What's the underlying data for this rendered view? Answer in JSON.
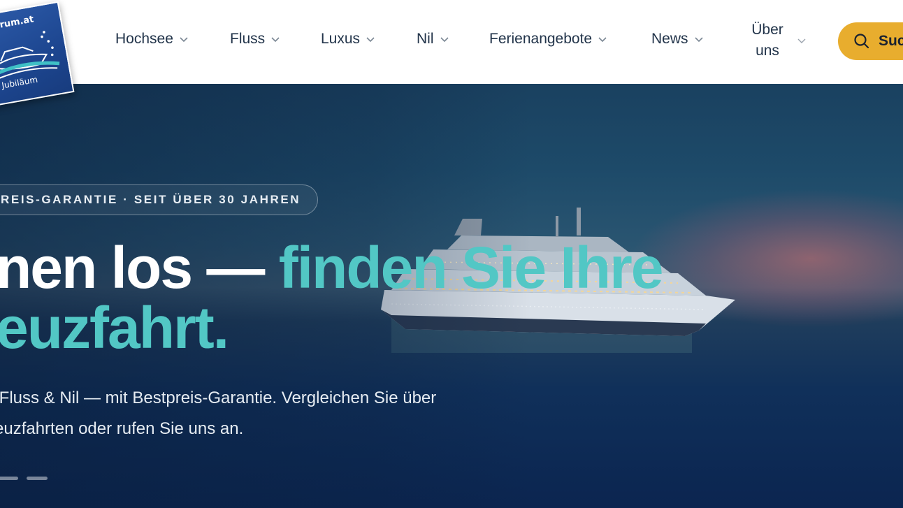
{
  "logo": {
    "top_text": "ntrum.at",
    "bottom_text": "e Jubiläum"
  },
  "nav": {
    "items": [
      {
        "label": "Hochsee"
      },
      {
        "label": "Fluss"
      },
      {
        "label": "Luxus"
      },
      {
        "label": "Nil"
      },
      {
        "label": "Ferienangebote"
      },
      {
        "label": "News"
      },
      {
        "label_line1": "Über",
        "label_line2": "uns"
      }
    ],
    "search_label": "Suc"
  },
  "hero": {
    "badge": "REIS-GARANTIE · SEIT ÜBER 30 JAHREN",
    "headline_white": "nen los — ",
    "headline_accent_1": "finden Sie Ihre",
    "headline_accent_2": "euzfahrt.",
    "subtext_line1": " Fluss & Nil — mit Bestpreis-Garantie. Vergleichen Sie über",
    "subtext_line2": "euzfahrten oder rufen Sie uns an.",
    "carousel_dot_count": 2
  },
  "colors": {
    "accent_teal": "#52c7c5",
    "search_button": "#e8ad2e",
    "logo_blue": "#1d4690",
    "nav_text": "#22344a"
  },
  "icons": {
    "search": "search-icon",
    "chevron": "chevron-down-icon",
    "logo": "ship-logo-icon"
  }
}
